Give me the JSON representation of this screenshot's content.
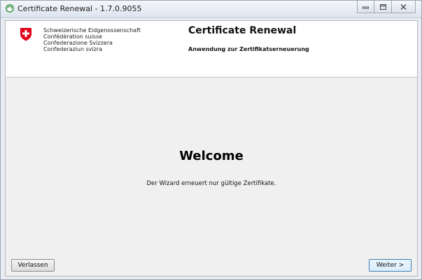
{
  "window": {
    "title": "Certificate Renewal - 1.7.0.9055",
    "controls": [
      "minimize-icon",
      "restore-icon",
      "close-icon"
    ]
  },
  "header": {
    "org_lines": [
      "Schweizerische Eidgenossenschaft",
      "Confédération suisse",
      "Confederazione Svizzera",
      "Confederaziun svizra"
    ],
    "title": "Certificate Renewal",
    "subtitle": "Anwendung zur Zertifikatserneuerung"
  },
  "main": {
    "heading": "Welcome",
    "info": "Der Wizard erneuert nur gültige Zertifikate."
  },
  "footer": {
    "leave_label": "Verlassen",
    "next_label": "Weiter >"
  },
  "colors": {
    "swiss_red": "#e2001a",
    "accent": "#3c7fb1"
  }
}
